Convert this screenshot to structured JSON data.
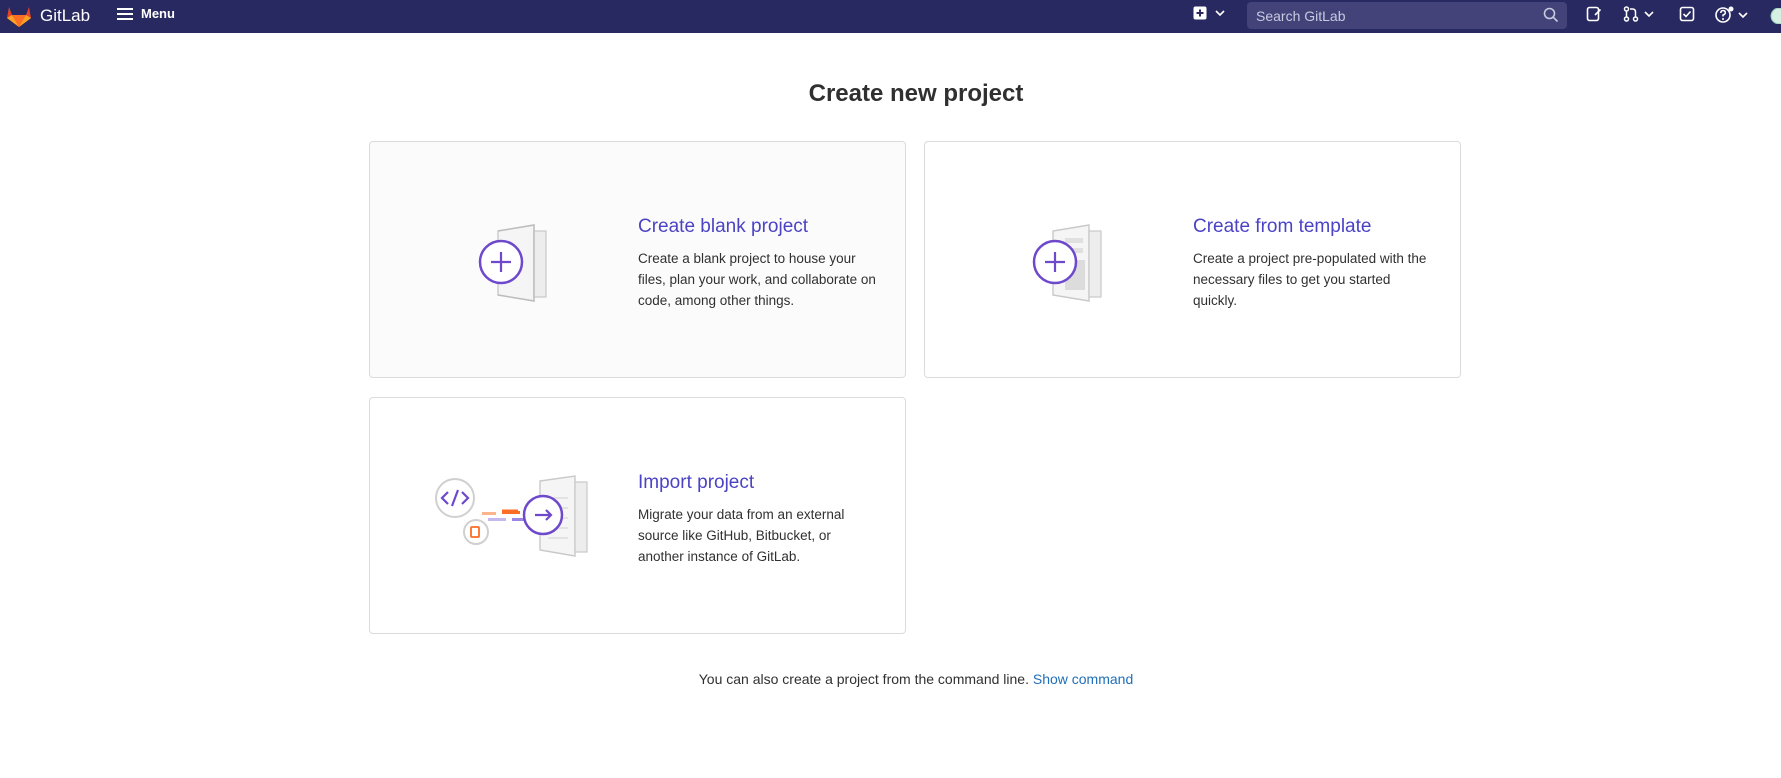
{
  "navbar": {
    "brand": "GitLab",
    "menu_label": "Menu",
    "search_placeholder": "Search GitLab",
    "colors": {
      "background": "#292961",
      "search_bg": "#43437a"
    },
    "icons": [
      "gitlab-logo-icon",
      "hamburger-icon",
      "new-item-icon",
      "chevron-down-icon",
      "search-icon",
      "issues-icon",
      "merge-requests-icon",
      "todo-icon",
      "help-icon",
      "avatar"
    ]
  },
  "page": {
    "title": "Create new project"
  },
  "cards": [
    {
      "title": "Create blank project",
      "description": "Create a blank project to house your files, plan your work, and collaborate on code, among other things."
    },
    {
      "title": "Create from template",
      "description": "Create a project pre-populated with the necessary files to get you started quickly."
    },
    {
      "title": "Import project",
      "description": "Migrate your data from an external source like GitHub, Bitbucket, or another instance of GitLab."
    }
  ],
  "footer": {
    "text": "You can also create a project from the command line.",
    "link": "Show command"
  },
  "colors": {
    "accent": "#6e49cb",
    "link": "#1f6fb8",
    "card_title": "#4b43c4"
  }
}
